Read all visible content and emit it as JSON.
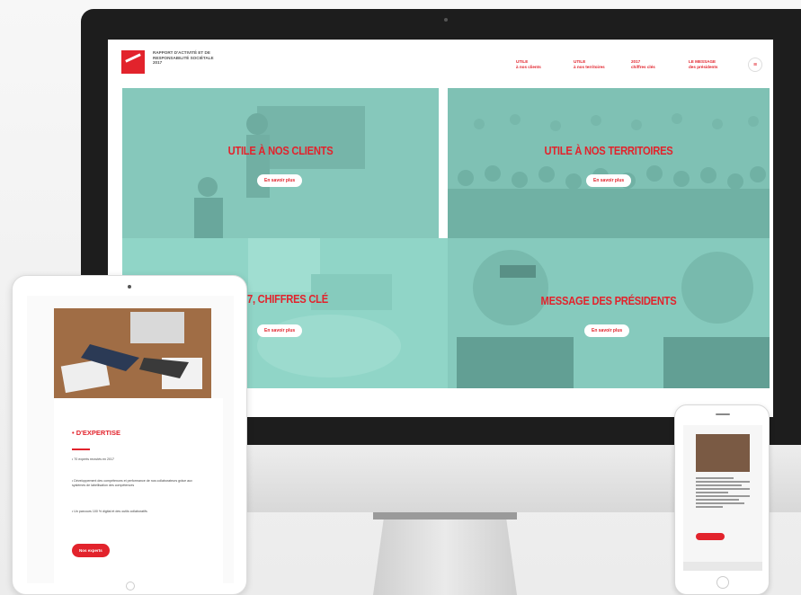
{
  "site": {
    "brand": [
      "RAPPORT D'ACTIVITÉ ET DE",
      "RESPONSABILITÉ SOCIÉTALE",
      "2017"
    ],
    "nav": [
      {
        "line1": "UTILE",
        "line2": "à nos clients"
      },
      {
        "line1": "UTILE",
        "line2": "à nos territoires"
      },
      {
        "line1": "2017",
        "line2": "chiffres clés"
      },
      {
        "line1": "LE MESSAGE",
        "line2": "des présidents"
      }
    ],
    "tiles": [
      {
        "title": "UTILE À NOS CLIENTS",
        "button": "En savoir plus"
      },
      {
        "title": "UTILE À NOS TERRITOIRES",
        "button": "En savoir plus"
      },
      {
        "title": "17, CHIFFRES CLÉ",
        "button": "En savoir plus"
      },
      {
        "title": "MESSAGE DES PRÉSIDENTS",
        "button": "En savoir plus"
      }
    ]
  },
  "tablet": {
    "title": "• D'EXPERTISE",
    "paragraphs": [
      "• 70 experts recrutés en 2017",
      "• Développement des compétences et performance de nos collaborateurs grâce aux systèmes de labellisation des compétences",
      "• Un parcours 100 % digital et des outils collaboratifs"
    ],
    "button": "Nos experts"
  },
  "colors": {
    "accent": "#e2232c",
    "overlay": "#80d6c4"
  }
}
